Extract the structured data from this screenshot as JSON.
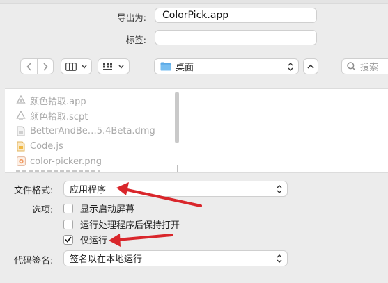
{
  "export": {
    "export_as_label": "导出为:",
    "export_as_value": "ColorPick.app",
    "tags_label": "标签:",
    "tags_value": ""
  },
  "toolbar": {
    "location": "桌面",
    "search_placeholder": "搜索"
  },
  "files": [
    {
      "name": "颜色拾取.app",
      "icon": "app-icon"
    },
    {
      "name": "颜色拾取.scpt",
      "icon": "script-icon"
    },
    {
      "name": "BetterAndBe…5.4Beta.dmg",
      "icon": "disk-image-icon"
    },
    {
      "name": "Code.js",
      "icon": "js-file-icon"
    },
    {
      "name": "color-picker.png",
      "icon": "image-file-icon"
    }
  ],
  "options": {
    "file_format_label": "文件格式:",
    "file_format_value": "应用程序",
    "options_label": "选项:",
    "checkboxes": [
      {
        "label": "显示启动屏幕",
        "checked": false
      },
      {
        "label": "运行处理程序后保持打开",
        "checked": false
      },
      {
        "label": "仅运行",
        "checked": true
      }
    ],
    "code_sign_label": "代码签名:",
    "code_sign_value": "签名以在本地运行"
  },
  "colors": {
    "annotation_arrow": "#d9262b",
    "folder": "#5aa9e6"
  }
}
